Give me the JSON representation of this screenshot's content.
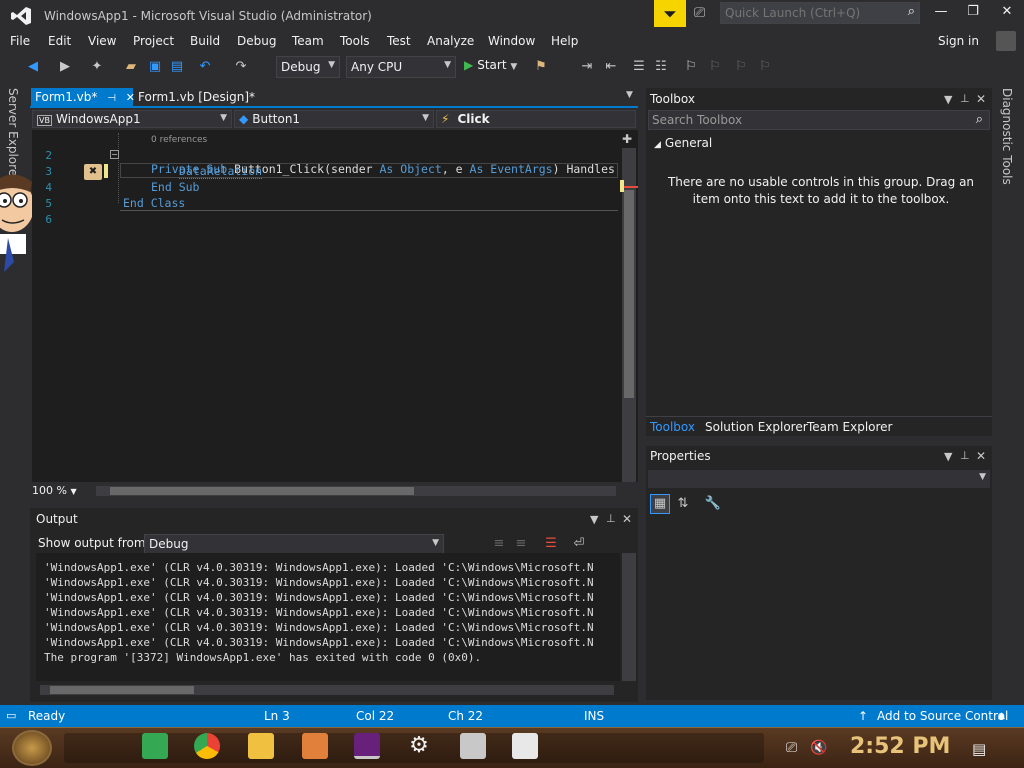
{
  "window": {
    "title": "WindowsApp1 - Microsoft Visual Studio  (Administrator)",
    "quick_launch_placeholder": "Quick Launch (Ctrl+Q)",
    "sign_in": "Sign in"
  },
  "menu": [
    "File",
    "Edit",
    "View",
    "Project",
    "Build",
    "Debug",
    "Team",
    "Tools",
    "Test",
    "Analyze",
    "Window",
    "Help"
  ],
  "toolbar": {
    "config": "Debug",
    "platform": "Any CPU",
    "start": "Start"
  },
  "side_tabs": {
    "left": "Server Explorer",
    "right": "Diagnostic Tools"
  },
  "doc_tabs": [
    {
      "label": "Form1.vb*",
      "active": true
    },
    {
      "label": "Form1.vb [Design]*",
      "active": false
    }
  ],
  "nav": {
    "project": "WindowsApp1",
    "object": "Button1",
    "event": "Click",
    "project_badge": "VB"
  },
  "editor": {
    "references": "0 references",
    "lines": [
      {
        "no": "2",
        "parts": [
          [
            "kw",
            "Private Sub "
          ],
          [
            "txt",
            "Button1_Click(sender "
          ],
          [
            "kw",
            "As Object"
          ],
          [
            "txt",
            ", e "
          ],
          [
            "kw",
            "As EventArgs"
          ],
          [
            "txt",
            ") Handles"
          ]
        ]
      },
      {
        "no": "3",
        "parts": [
          [
            "err",
            "DataRelation"
          ]
        ]
      },
      {
        "no": "4",
        "parts": [
          [
            "kw",
            "End Sub"
          ]
        ]
      },
      {
        "no": "5",
        "parts": [
          [
            "kw",
            "End Class"
          ]
        ]
      },
      {
        "no": "6",
        "parts": []
      }
    ],
    "zoom": "100 %"
  },
  "output": {
    "title": "Output",
    "show_from_label": "Show output from:",
    "show_from_value": "Debug",
    "lines": [
      "'WindowsApp1.exe' (CLR v4.0.30319: WindowsApp1.exe): Loaded 'C:\\Windows\\Microsoft.N",
      "'WindowsApp1.exe' (CLR v4.0.30319: WindowsApp1.exe): Loaded 'C:\\Windows\\Microsoft.N",
      "'WindowsApp1.exe' (CLR v4.0.30319: WindowsApp1.exe): Loaded 'C:\\Windows\\Microsoft.N",
      "'WindowsApp1.exe' (CLR v4.0.30319: WindowsApp1.exe): Loaded 'C:\\Windows\\Microsoft.N",
      "'WindowsApp1.exe' (CLR v4.0.30319: WindowsApp1.exe): Loaded 'C:\\Windows\\Microsoft.N",
      "'WindowsApp1.exe' (CLR v4.0.30319: WindowsApp1.exe): Loaded 'C:\\Windows\\Microsoft.N",
      "The program '[3372] WindowsApp1.exe' has exited with code 0 (0x0)."
    ]
  },
  "toolbox": {
    "title": "Toolbox",
    "search_placeholder": "Search Toolbox",
    "group": "General",
    "empty_message": "There are no usable controls in this group. Drag an item onto this text to add it to the toolbox.",
    "bottom_tabs": [
      "Toolbox",
      "Solution Explorer",
      "Team Explorer"
    ]
  },
  "properties": {
    "title": "Properties"
  },
  "status": {
    "ready": "Ready",
    "ln": "Ln 3",
    "col": "Col 22",
    "ch": "Ch 22",
    "ins": "INS",
    "source_control": "Add to Source Control"
  },
  "taskbar": {
    "clock": "2:52 PM"
  },
  "colors": {
    "accent": "#007acc",
    "background": "#2d2d30",
    "editor_bg": "#1e1e1e",
    "keyword": "#569cd6",
    "notification": "#f5d400"
  }
}
